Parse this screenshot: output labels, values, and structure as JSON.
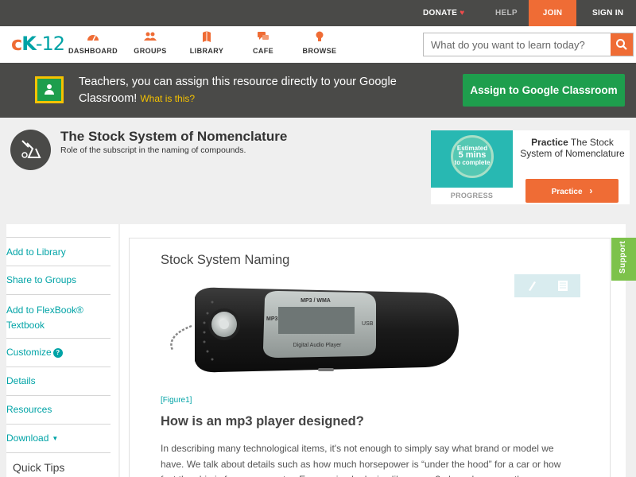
{
  "topbar": {
    "donate": "DONATE",
    "help": "HELP",
    "join": "JOIN",
    "signin": "SIGN IN"
  },
  "nav": {
    "logo_c": "c",
    "logo_k": "K",
    "logo_num": "-12",
    "items": [
      {
        "label": "DASHBOARD",
        "icon": "dashboard-gauge-icon"
      },
      {
        "label": "GROUPS",
        "icon": "groups-people-icon"
      },
      {
        "label": "LIBRARY",
        "icon": "library-book-icon"
      },
      {
        "label": "CAFE",
        "icon": "cafe-chat-icon"
      },
      {
        "label": "BROWSE",
        "icon": "browse-bulb-icon"
      }
    ],
    "search_placeholder": "What do you want to learn today?"
  },
  "banner": {
    "text": "Teachers, you can assign this resource directly to your Google Classroom!",
    "what_link": "What is this?",
    "button": "Assign to Google Classroom"
  },
  "header": {
    "title": "The Stock System of Nomenclature",
    "subtitle": "Role of the subscript in the naming of compounds."
  },
  "practice": {
    "estimated": "Estimated",
    "mins": "5 mins",
    "to_complete": "to complete",
    "progress": "PROGRESS",
    "title_bold": "Practice",
    "title_rest": "The Stock System of Nomenclature",
    "button": "Practice"
  },
  "sidebar": {
    "items": [
      {
        "label": "Add to Library"
      },
      {
        "label": "Share to Groups"
      },
      {
        "label": "Add to FlexBook® Textbook"
      },
      {
        "label": "Customize"
      },
      {
        "label": "Details"
      },
      {
        "label": "Resources"
      },
      {
        "label": "Download"
      }
    ],
    "quick_tips": "Quick Tips"
  },
  "content": {
    "section_title": "Stock System Naming",
    "figure_caption": "[Figure1]",
    "question": "How is an mp3 player designed?",
    "paragraph": "In describing many technological items, it's not enough to simply say what brand or model we have. We talk about details such as how much horsepower is “under the hood” for a car or how fast the chip is for our computer.  Even a simple device like an mp3 player has more than one",
    "mp3_screen_top": "MP3 / WMA",
    "mp3_screen_bottom": "Digital Audio Player",
    "mp3_badge": "MP3",
    "mp3_usb": "USB"
  },
  "support": "Support",
  "colors": {
    "orange": "#ef6c35",
    "teal": "#00a3a6",
    "dark": "#4a4a48",
    "google_green": "#1e9e4d",
    "support_green": "#7dc24b"
  }
}
